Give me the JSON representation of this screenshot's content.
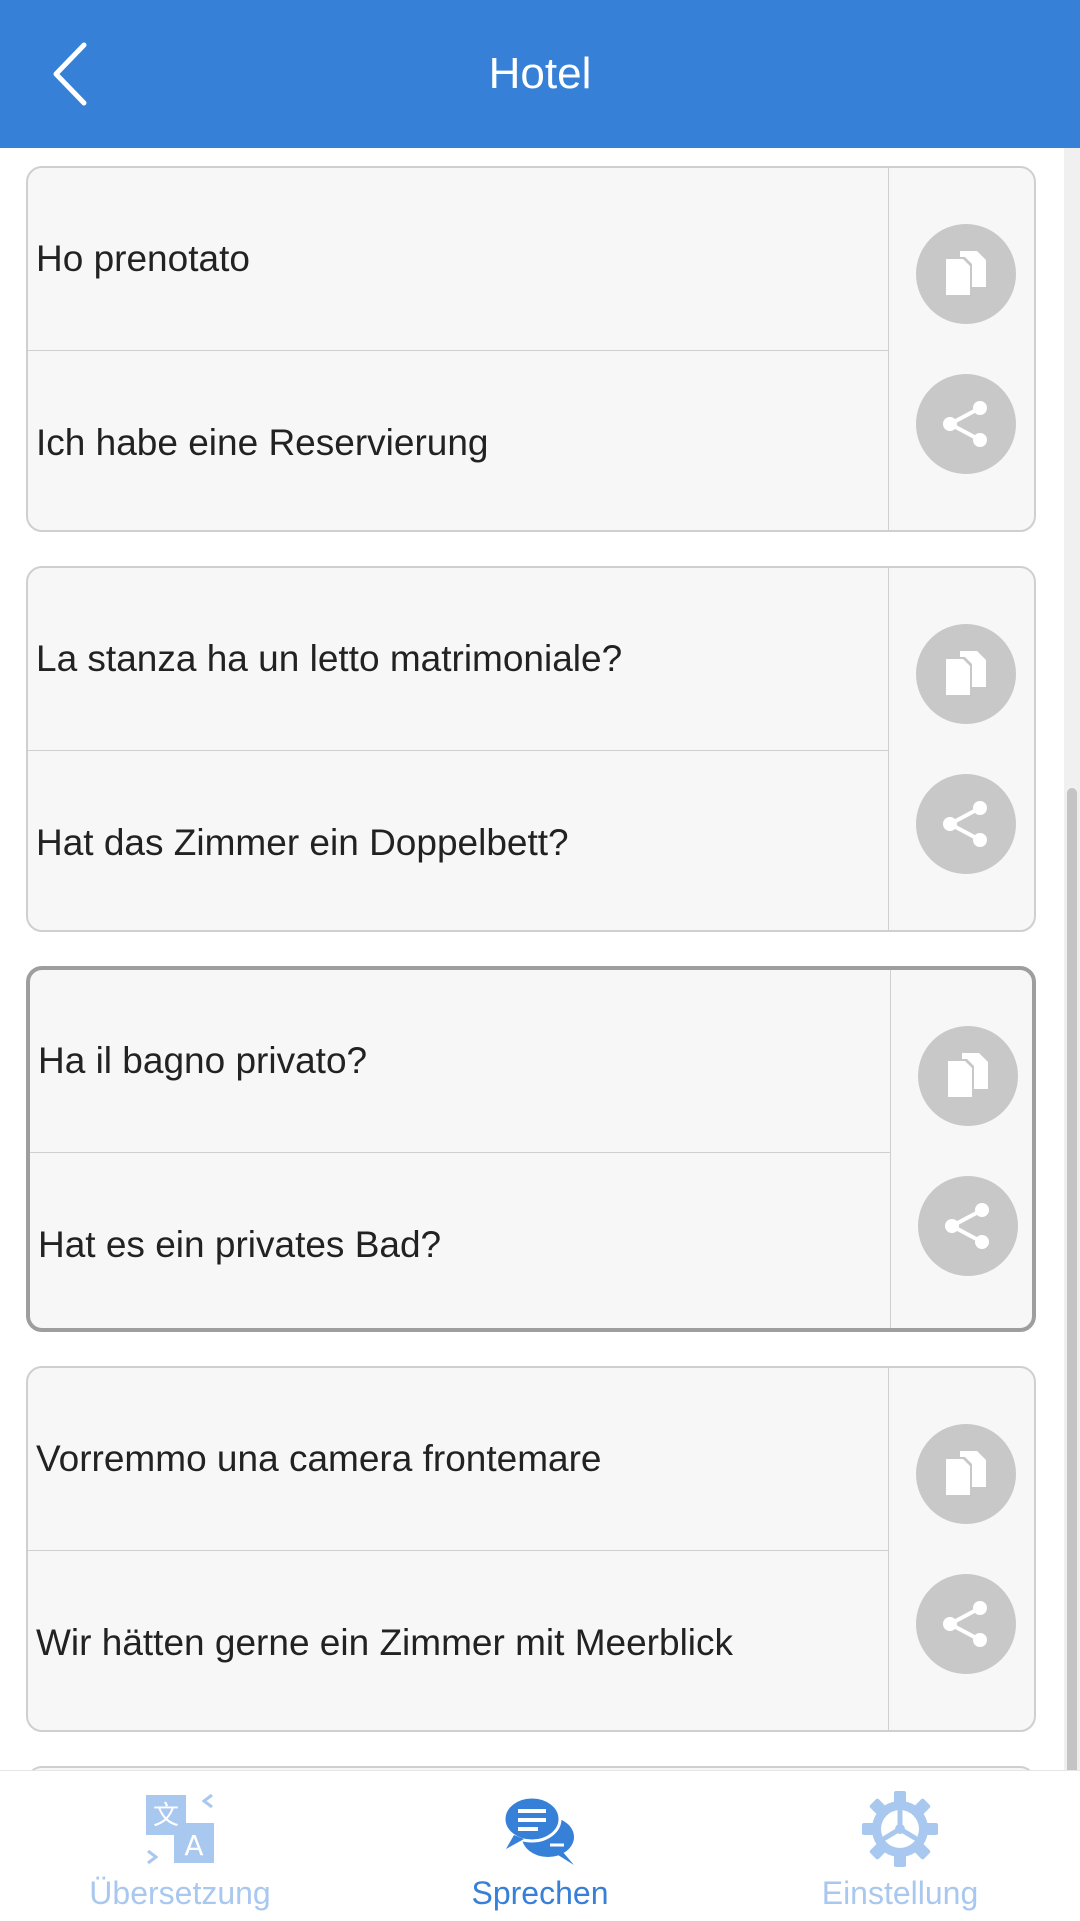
{
  "header": {
    "title": "Hotel"
  },
  "phrases": [
    {
      "source": "Ho prenotato",
      "translation": "Ich habe eine Reservierung"
    },
    {
      "source": "La stanza ha un letto matrimoniale?",
      "translation": "Hat das Zimmer ein Doppelbett?"
    },
    {
      "source": "Ha il bagno privato?",
      "translation": "Hat es ein privates Bad?"
    },
    {
      "source": "Vorremmo una camera frontemare",
      "translation": "Wir hätten gerne ein Zimmer mit Meerblick"
    }
  ],
  "selected_phrase_index": 2,
  "tabs": [
    {
      "label": "Übersetzung",
      "icon": "translate-icon",
      "active": false
    },
    {
      "label": "Sprechen",
      "icon": "chat-bubbles-icon",
      "active": true
    },
    {
      "label": "Einstellung",
      "icon": "gear-icon",
      "active": false
    }
  ],
  "colors": {
    "header_bg": "#3780d8",
    "accent": "#3780d8",
    "inactive_tab": "#a9c8ef",
    "action_circle": "#c8c8c8"
  }
}
